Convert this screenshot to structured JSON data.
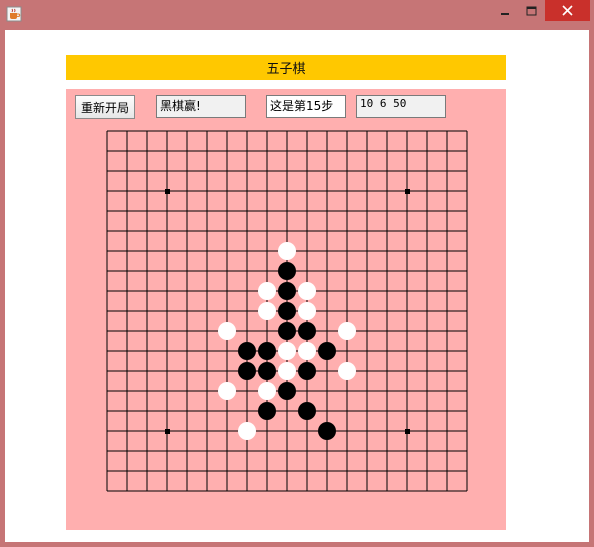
{
  "window": {
    "app_icon": "java-coffee-icon",
    "controls": {
      "minimize": "—",
      "maximize": "☐",
      "close": "✕"
    }
  },
  "game": {
    "title": "五子棋",
    "restart_label": "重新开局",
    "status_text": "黑棋赢!",
    "step_text": "这是第15步",
    "info_text": "10 6 50"
  },
  "colors": {
    "title_banner": "#ffc800",
    "panel_bg": "#ffafaf",
    "board_line": "#000000",
    "black_stone": "#000000",
    "white_stone": "#ffffff"
  },
  "board": {
    "size": 19,
    "star_points": [
      [
        3,
        3
      ],
      [
        15,
        3
      ],
      [
        3,
        15
      ],
      [
        15,
        15
      ]
    ],
    "black_stones": [
      [
        9,
        7
      ],
      [
        9,
        8
      ],
      [
        9,
        9
      ],
      [
        9,
        10
      ],
      [
        10,
        10
      ],
      [
        11,
        11
      ],
      [
        7,
        11
      ],
      [
        8,
        11
      ],
      [
        7,
        12
      ],
      [
        8,
        12
      ],
      [
        10,
        12
      ],
      [
        9,
        13
      ],
      [
        8,
        14
      ],
      [
        10,
        14
      ],
      [
        11,
        15
      ]
    ],
    "white_stones": [
      [
        9,
        6
      ],
      [
        8,
        8
      ],
      [
        10,
        8
      ],
      [
        8,
        9
      ],
      [
        10,
        9
      ],
      [
        6,
        10
      ],
      [
        12,
        10
      ],
      [
        9,
        11
      ],
      [
        10,
        11
      ],
      [
        9,
        12
      ],
      [
        12,
        12
      ],
      [
        6,
        13
      ],
      [
        8,
        13
      ],
      [
        7,
        15
      ]
    ]
  }
}
